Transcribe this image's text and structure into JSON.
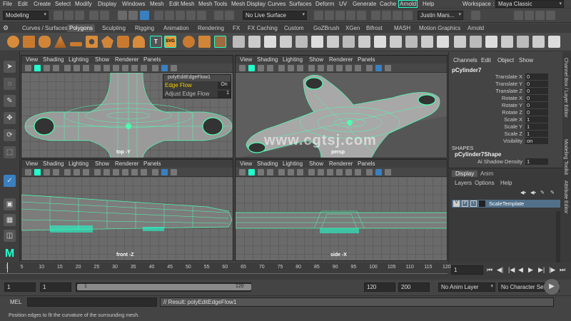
{
  "menubar": {
    "items": [
      "File",
      "Edit",
      "Create",
      "Select",
      "Modify",
      "Display",
      "Windows",
      "Mesh",
      "Edit Mesh",
      "Mesh Tools",
      "Mesh Display",
      "Curves",
      "Surfaces",
      "Deform",
      "UV",
      "Generate",
      "Cache",
      "Arnold",
      "Help"
    ],
    "workspace_label": "Workspace :",
    "workspace_value": "Maya Classic"
  },
  "statusline": {
    "menuset": "Modeling",
    "live_surface": "No Live Surface",
    "user": "Justin Mars..."
  },
  "shelf": {
    "tabs": [
      "Curves / Surfaces",
      "Polygons",
      "Sculpting",
      "Rigging",
      "Animation",
      "Rendering",
      "FX",
      "FX Caching",
      "Custom",
      "GoZBrush",
      "XGen",
      "Bifrost",
      "MASH",
      "Motion Graphics",
      "Arnold"
    ],
    "active": "Polygons"
  },
  "viewport_menu": [
    "View",
    "Shading",
    "Lighting",
    "Show",
    "Renderer",
    "Panels"
  ],
  "viewports": {
    "top_label": "top -Y",
    "persp_label": "persp",
    "front_label": "front -Z",
    "side_label": "side -X"
  },
  "popup": {
    "title": "polyEditEdgeFlow1",
    "row1_label": "Edge Flow",
    "row1_value": "On",
    "row2_label": "Adjust Edge Flow",
    "row2_value": "1"
  },
  "watermark": "www.cgtsj.com",
  "channelbox": {
    "menus": [
      "Channels",
      "Edit",
      "Object",
      "Show"
    ],
    "object": "pCylinder7",
    "attrs": [
      {
        "n": "Translate X",
        "v": "0"
      },
      {
        "n": "Translate Y",
        "v": "0"
      },
      {
        "n": "Translate Z",
        "v": "0"
      },
      {
        "n": "Rotate X",
        "v": "0"
      },
      {
        "n": "Rotate Y",
        "v": "0"
      },
      {
        "n": "Rotate Z",
        "v": "0"
      },
      {
        "n": "Scale X",
        "v": "1"
      },
      {
        "n": "Scale Y",
        "v": "1"
      },
      {
        "n": "Scale Z",
        "v": "1"
      },
      {
        "n": "Visibility",
        "v": "on"
      }
    ],
    "shapes_header": "SHAPES",
    "shape_name": "pCylinder7Shape",
    "shadow_label": "Ai Shadow Density",
    "shadow_value": "1"
  },
  "layers": {
    "tabs": [
      "Display",
      "Anim"
    ],
    "menus": [
      "Layers",
      "Options",
      "Help"
    ],
    "layer_name": "ScaleTemplate",
    "v": "V",
    "p": "P",
    "t": "T"
  },
  "side_tabs": [
    "Channel Box / Layer Editor",
    "Modeling Toolkit",
    "Attribute Editor"
  ],
  "timeslider": {
    "ticks": [
      "1",
      "5",
      "10",
      "15",
      "20",
      "25",
      "30",
      "35",
      "40",
      "45",
      "50",
      "55",
      "60",
      "65",
      "70",
      "75",
      "80",
      "85",
      "90",
      "95",
      "100",
      "105",
      "110",
      "115",
      "120"
    ],
    "current": "1"
  },
  "range": {
    "start": "1",
    "start2": "1",
    "slider_start": "1",
    "slider_end": "120",
    "end": "120",
    "end2": "200",
    "anim_layer": "No Anim Layer",
    "char_set": "No Character Set"
  },
  "cmd": {
    "lang": "MEL",
    "result": "// Result: polyEditEdgeFlow1"
  },
  "help": "Position edges to fit the curvature of the surrounding mesh.",
  "colors": {
    "accent": "#2fd0a0",
    "wire": "#4dffb0",
    "select": "#2fc"
  }
}
